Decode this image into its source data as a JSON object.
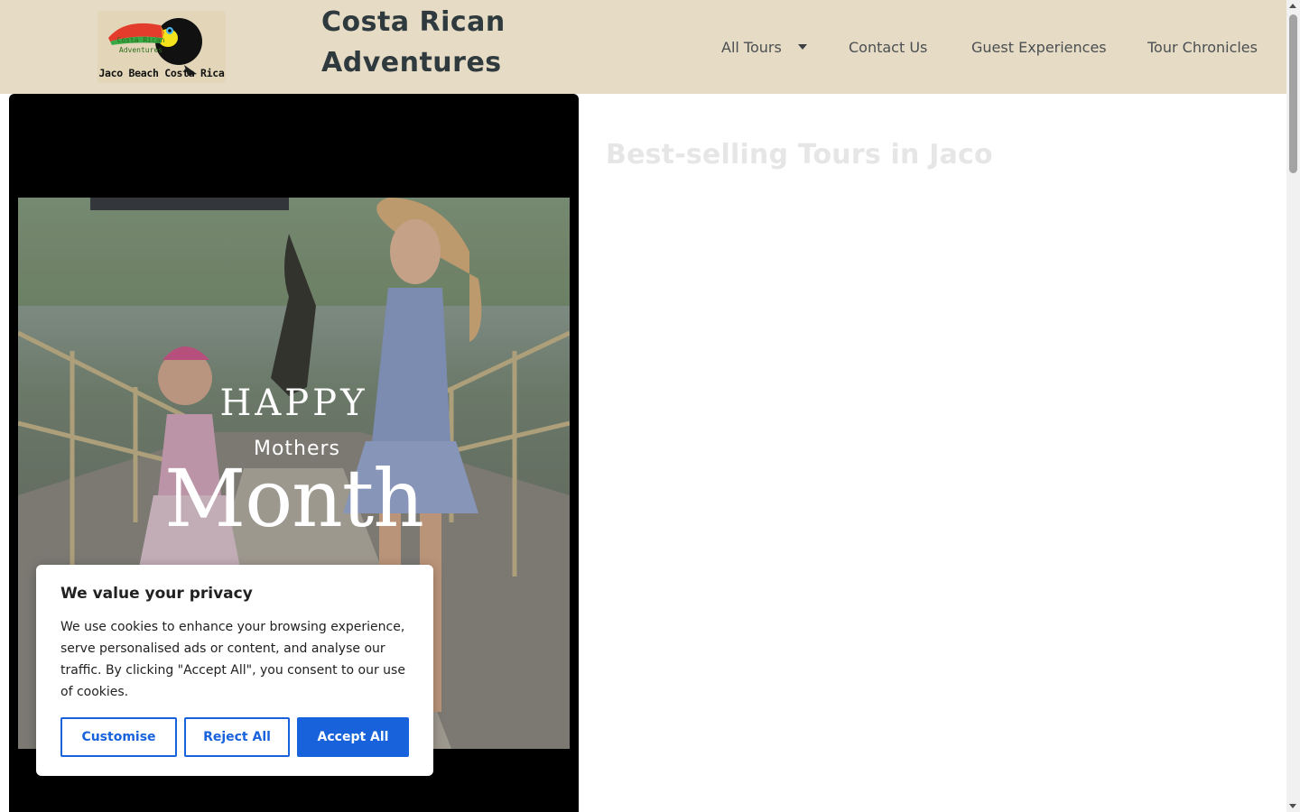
{
  "header": {
    "logo_caption": "Jaco Beach Costa Rica",
    "logo_small_text": "Costa Rican Adventures",
    "site_title": "Costa Rican Adventures",
    "nav": [
      {
        "label": "All Tours",
        "has_dropdown": true
      },
      {
        "label": "Contact Us"
      },
      {
        "label": "Guest Experiences"
      },
      {
        "label": "Tour Chronicles"
      }
    ]
  },
  "hero": {
    "happy": "HAPPY",
    "mothers": "Mothers",
    "month": "Month"
  },
  "main": {
    "section_title": "Best-selling Tours in Jaco"
  },
  "cookie_banner": {
    "title": "We value your privacy",
    "text": "We use cookies to enhance your browsing experience, serve personalised ads or content, and analyse our traffic. By clicking \"Accept All\", you consent to our use of cookies.",
    "customise_label": "Customise",
    "reject_label": "Reject All",
    "accept_label": "Accept All"
  },
  "colors": {
    "header_bg": "#e6dbc5",
    "accent_blue": "#1863dc",
    "title_text": "#2f3a3e"
  }
}
